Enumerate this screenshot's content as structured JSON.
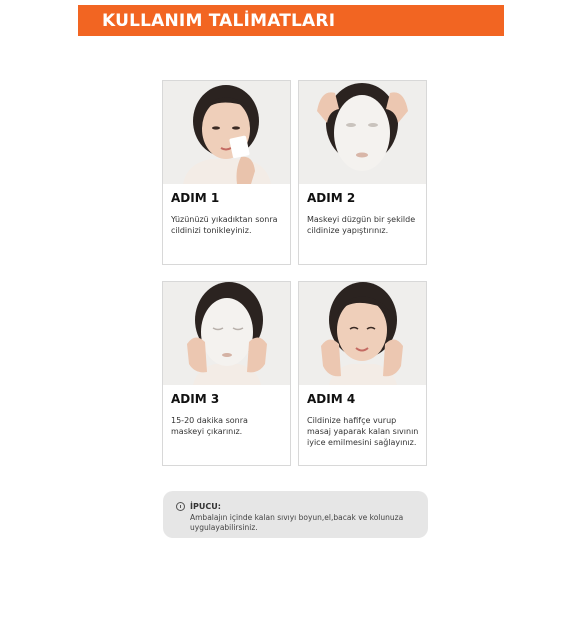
{
  "header": {
    "title": "KULLANIM TALİMATLARI"
  },
  "steps": [
    {
      "title": "ADIM 1",
      "description": "Yüzünüzü yıkadıktan sonra cildinizi tonikleyiniz."
    },
    {
      "title": "ADIM 2",
      "description": "Maskeyi düzgün bir şekilde cildinize yapıştırınız."
    },
    {
      "title": "ADIM 3",
      "description": "15-20 dakika sonra maskeyi çıkarınız."
    },
    {
      "title": "ADIM 4",
      "description": "Cildinize hafifçe vurup masaj yaparak  kalan sıvının iyice emilmesini sağlayınız."
    }
  ],
  "tip": {
    "icon": "info-icon",
    "title": "İPUCU:",
    "text": "Ambalajın içinde kalan sıvıyı boyun,el,bacak ve kolunuza uygulayabilirsiniz."
  },
  "colors": {
    "accent": "#f26522",
    "tip_background": "#e6e6e6",
    "card_border": "#d8d8d8"
  }
}
